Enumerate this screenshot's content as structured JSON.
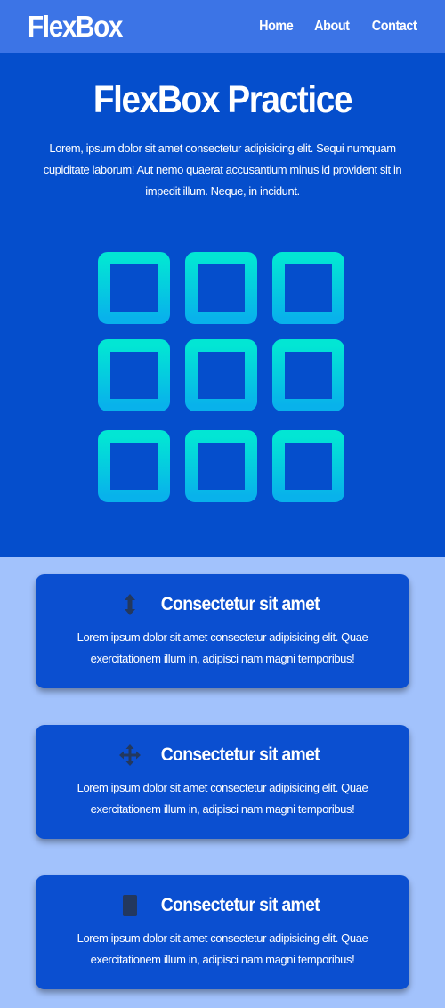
{
  "navbar": {
    "logo": "FlexBox",
    "links": [
      {
        "label": "Home"
      },
      {
        "label": "About"
      },
      {
        "label": "Contact"
      }
    ]
  },
  "hero": {
    "title": "FlexBox Practice",
    "text": "Lorem, ipsum dolor sit amet consectetur adipisicing elit. Sequi numquam cupiditate laborum! Aut nemo quaerat accusantium minus id provident sit in impedit illum. Neque, in incidunt.",
    "grid_icon": "grid-3x3-icon",
    "colors": {
      "gradient_top": "#02e6d4",
      "gradient_bottom": "#08b2eb"
    }
  },
  "cards": [
    {
      "icon": "vertical-arrows-icon",
      "title": "Consectetur sit amet",
      "text": "Lorem ipsum dolor sit amet consectetur adipisicing elit. Quae exercitationem illum in, adipisci nam magni temporibus!"
    },
    {
      "icon": "move-arrows-icon",
      "title": "Consectetur sit amet",
      "text": "Lorem ipsum dolor sit amet consectetur adipisicing elit. Quae exercitationem illum in, adipisci nam magni temporibus!"
    },
    {
      "icon": "mobile-icon",
      "title": "Consectetur sit amet",
      "text": "Lorem ipsum dolor sit amet consectetur adipisicing elit. Quae exercitationem illum in, adipisci nam magni temporibus!"
    }
  ],
  "colors": {
    "navbar_bg": "#3c74e6",
    "hero_bg": "#054ecc",
    "page_bg": "#a2c2fc",
    "card_bg": "#0b4fd0",
    "card_icon": "#23385e"
  }
}
